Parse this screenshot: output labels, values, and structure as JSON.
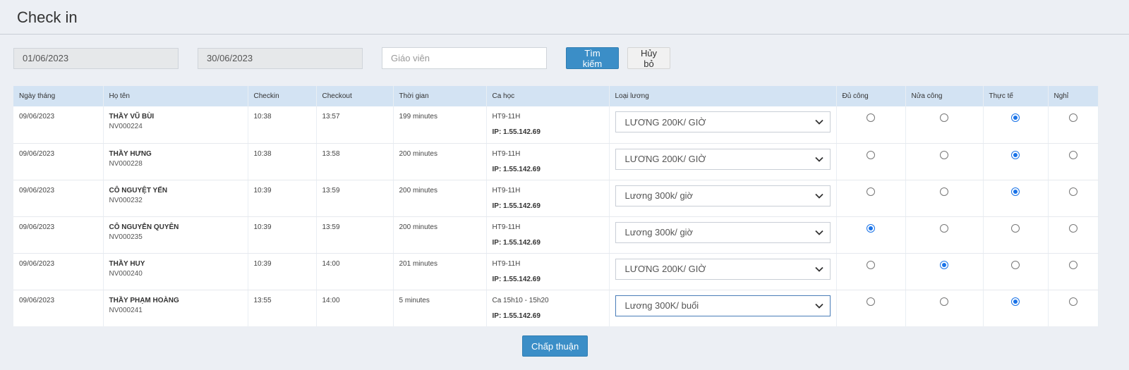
{
  "page": {
    "title": "Check in"
  },
  "filters": {
    "date_from": "01/06/2023",
    "date_to": "30/06/2023",
    "teacher_placeholder": "Giáo viên",
    "search_label": "Tìm kiếm",
    "cancel_label": "Hủy bỏ"
  },
  "table": {
    "headers": [
      "Ngày tháng",
      "Họ tên",
      "Checkin",
      "Checkout",
      "Thời gian",
      "Ca học",
      "Loại lương",
      "Đủ công",
      "Nửa công",
      "Thực tế",
      "Nghỉ"
    ],
    "rows": [
      {
        "date": "09/06/2023",
        "name": "THẦY VŨ BÙI",
        "code": "NV000224",
        "checkin": "10:38",
        "checkout": "13:57",
        "duration": "199 minutes",
        "shift": "HT9-11H",
        "ip": "IP: 1.55.142.69",
        "salary": "LƯƠNG 200K/ GIỜ",
        "selected": "thuc_te"
      },
      {
        "date": "09/06/2023",
        "name": "THẦY HƯNG",
        "code": "NV000228",
        "checkin": "10:38",
        "checkout": "13:58",
        "duration": "200 minutes",
        "shift": "HT9-11H",
        "ip": "IP: 1.55.142.69",
        "salary": "LƯƠNG 200K/ GIỜ",
        "selected": "thuc_te"
      },
      {
        "date": "09/06/2023",
        "name": "CÔ NGUYỆT YẾN",
        "code": "NV000232",
        "checkin": "10:39",
        "checkout": "13:59",
        "duration": "200 minutes",
        "shift": "HT9-11H",
        "ip": "IP: 1.55.142.69",
        "salary": "Lương 300k/ giờ",
        "selected": "thuc_te"
      },
      {
        "date": "09/06/2023",
        "name": "CÔ NGUYỄN QUYÊN",
        "code": "NV000235",
        "checkin": "10:39",
        "checkout": "13:59",
        "duration": "200 minutes",
        "shift": "HT9-11H",
        "ip": "IP: 1.55.142.69",
        "salary": "Lương 300k/ giờ",
        "selected": "du_cong"
      },
      {
        "date": "09/06/2023",
        "name": "THẦY HUY",
        "code": "NV000240",
        "checkin": "10:39",
        "checkout": "14:00",
        "duration": "201 minutes",
        "shift": "HT9-11H",
        "ip": "IP: 1.55.142.69",
        "salary": "LƯƠNG 200K/ GIỜ",
        "selected": "nua_cong"
      },
      {
        "date": "09/06/2023",
        "name": "THẦY PHẠM HOÀNG",
        "code": "NV000241",
        "checkin": "13:55",
        "checkout": "14:00",
        "duration": "5 minutes",
        "shift": "Ca 15h10 - 15h20",
        "ip": "IP: 1.55.142.69",
        "salary": "Lương 300K/ buổi",
        "selected": "thuc_te"
      }
    ]
  },
  "footer": {
    "approve_label": "Chấp thuận"
  },
  "colors": {
    "accent": "#3b8ec7",
    "header_bg": "#d3e3f3",
    "radio_selected": "#1a73e8"
  }
}
